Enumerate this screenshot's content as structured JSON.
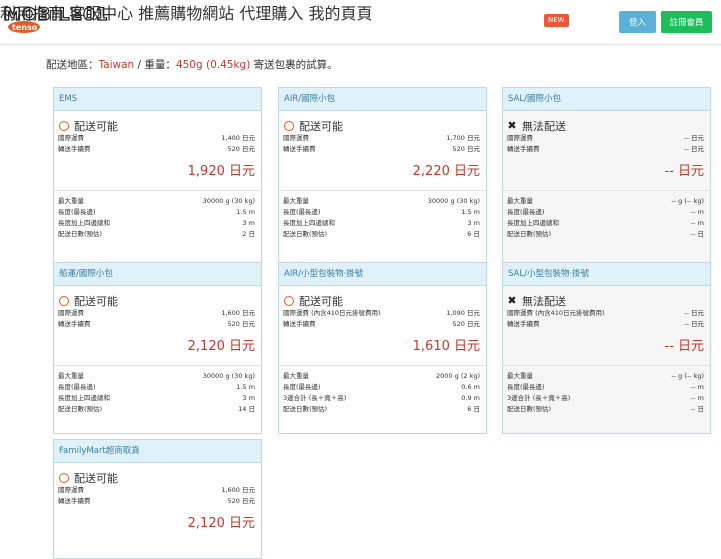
{
  "header": {
    "nav": [
      "利用指南",
      "客服中心",
      "推薦購物網站",
      "代理購入",
      "我的頁頁"
    ],
    "new_badge": "NEW",
    "login": "登入",
    "register": "註冊會員"
  },
  "info": {
    "prefix": "配送地區：",
    "country": "Taiwan",
    "sep": " / 重量：",
    "weight": "450g (0.45kg)",
    "suffix": " 寄送包裹的試算。"
  },
  "colors": {
    "accent_green": "#2e8b57",
    "price_red": "#c0392b",
    "card_head": "#dff2fa"
  },
  "cards": [
    {
      "title": "EMS",
      "available": true,
      "status": "配送可能",
      "fees": [
        [
          "國際運費",
          "1,400 日元"
        ],
        [
          "轉送手續費",
          "520 日元"
        ]
      ],
      "total": "1,920 日元",
      "specs": [
        [
          "最大重量",
          "30000 g (30 kg)"
        ],
        [
          "長度(最長邊)",
          "1.5 m"
        ],
        [
          "長度加上四邊總和",
          "3 m"
        ],
        [
          "配送日數(預估)",
          "2 日"
        ]
      ]
    },
    {
      "title": "AIR/國際小包",
      "available": true,
      "status": "配送可能",
      "fees": [
        [
          "國際運費",
          "1,700 日元"
        ],
        [
          "轉送手續費",
          "520 日元"
        ]
      ],
      "total": "2,220 日元",
      "specs": [
        [
          "最大重量",
          "30000 g (30 kg)"
        ],
        [
          "長度(最長邊)",
          "1.5 m"
        ],
        [
          "長度加上四邊總和",
          "3 m"
        ],
        [
          "配送日數(預估)",
          "6 日"
        ]
      ]
    },
    {
      "title": "SAL/國際小包",
      "available": false,
      "status": "無法配送",
      "fees": [
        [
          "國際運費",
          "-- 日元"
        ],
        [
          "轉送手續費",
          "-- 日元"
        ]
      ],
      "total": "-- 日元",
      "specs": [
        [
          "最大重量",
          "-- g (-- kg)"
        ],
        [
          "長度(最長邊)",
          "-- m"
        ],
        [
          "長度加上四邊總和",
          "-- m"
        ],
        [
          "配送日數(預估)",
          "-- 日"
        ]
      ]
    },
    {
      "title": "船運/國際小包",
      "available": true,
      "status": "配送可能",
      "fees": [
        [
          "國際運費",
          "1,600 日元"
        ],
        [
          "轉送手續費",
          "520 日元"
        ]
      ],
      "total": "2,120 日元",
      "specs": [
        [
          "最大重量",
          "30000 g (30 kg)"
        ],
        [
          "長度(最長邊)",
          "1.5 m"
        ],
        [
          "長度加上四邊總和",
          "3 m"
        ],
        [
          "配送日數(預估)",
          "14 日"
        ]
      ]
    },
    {
      "title": "AIR/小型包裝物·掛號",
      "available": true,
      "status": "配送可能",
      "fees": [
        [
          "國際運費 (內含410日元掛號費用)",
          "1,090 日元"
        ],
        [
          "轉送手續費",
          "520 日元"
        ]
      ],
      "total": "1,610 日元",
      "specs": [
        [
          "最大重量",
          "2000 g (2 kg)"
        ],
        [
          "長度(最長邊)",
          "0.6 m"
        ],
        [
          "3邊合計 (長＋寬＋高)",
          "0.9 m"
        ],
        [
          "配送日數(預估)",
          "6 日"
        ]
      ]
    },
    {
      "title": "SAL/小型包裝物·掛號",
      "available": false,
      "status": "無法配送",
      "fees": [
        [
          "國際運費 (內含410日元掛號費用)",
          "-- 日元"
        ],
        [
          "轉送手續費",
          "-- 日元"
        ]
      ],
      "total": "-- 日元",
      "specs": [
        [
          "最大重量",
          "-- g (-- kg)"
        ],
        [
          "長度(最長邊)",
          "-- m"
        ],
        [
          "3邊合計 (長＋寬＋高)",
          "-- m"
        ],
        [
          "配送日數(預估)",
          "-- 日"
        ]
      ]
    },
    {
      "title": "FamilyMart超商取貨",
      "available": true,
      "status": "配送可能",
      "fees": [
        [
          "國際運費",
          "1,600 日元"
        ],
        [
          "轉送手續費",
          "520 日元"
        ]
      ],
      "total": "2,120 日元",
      "specs": []
    }
  ]
}
